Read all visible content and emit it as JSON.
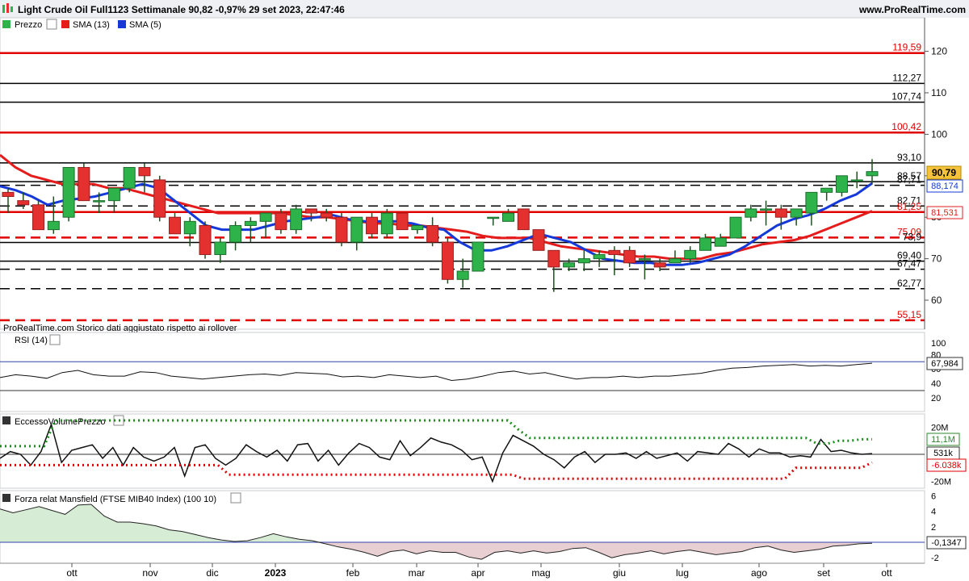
{
  "header": {
    "title": "Light Crude Oil Full1123 Settimanale 90,82 -0,97% 29 set 2023, 22:47:46",
    "site": "www.ProRealTime.com"
  },
  "colors": {
    "up": "#2db34a",
    "down": "#e53030",
    "sma13": "#e51c1c",
    "sma5": "#1538d8",
    "level_red": "#e00000",
    "level_black": "#000000",
    "mansfield_pos_fill": "#d6ecd4",
    "mansfield_neg_fill": "#e8cfd2"
  },
  "price_panel": {
    "legend": [
      {
        "label": "Prezzo",
        "icon": "candle-icon"
      },
      {
        "label": "SMA (13)",
        "icon": "red-square-icon"
      },
      {
        "label": "SMA (5)",
        "icon": "blue-square-icon"
      }
    ],
    "footer_text": "ProRealTime.com  Storico dati aggiustato rispetto ai rollover",
    "current_price_label": "90,79",
    "sma5_label": "88,174",
    "sma13_label": "81,531"
  },
  "rsi_panel": {
    "label": "RSI (14)",
    "value_label": "67,984"
  },
  "volume_panel": {
    "label": "EccessoVolumePrezzo",
    "upper_label": "11,1M",
    "value_label": "531k",
    "lower_label": "-6.038k"
  },
  "mansfield_panel": {
    "label": "Forza relat Mansfield (FTSE MIB40 Index) (100 10)",
    "value_label": "-0,1347"
  },
  "chart_data": [
    {
      "type": "candlestick",
      "title": "Light Crude Oil Full1123 Settimanale",
      "timeframe": "weekly",
      "x_tick_labels": [
        "ott",
        "nov",
        "dic",
        "2023",
        "feb",
        "mar",
        "apr",
        "mag",
        "giu",
        "lug",
        "ago",
        "set",
        "ott"
      ],
      "y_ticks": [
        60,
        70,
        80,
        90,
        100,
        110,
        120
      ],
      "ylim": [
        55,
        125
      ],
      "levels": [
        {
          "value": 119.59,
          "label": "119,59",
          "color": "red",
          "style": "solid"
        },
        {
          "value": 112.27,
          "label": "112,27",
          "color": "black",
          "style": "solid"
        },
        {
          "value": 107.74,
          "label": "107,74",
          "color": "black",
          "style": "solid"
        },
        {
          "value": 100.42,
          "label": "100,42",
          "color": "red",
          "style": "solid"
        },
        {
          "value": 93.1,
          "label": "93,10",
          "color": "black",
          "style": "solid"
        },
        {
          "value": 88.57,
          "label": "88,57",
          "color": "black",
          "style": "solid"
        },
        {
          "value": 87.71,
          "label": "87,71",
          "color": "black",
          "style": "dashed"
        },
        {
          "value": 82.71,
          "label": "82,71",
          "color": "black",
          "style": "dashed"
        },
        {
          "value": 81.25,
          "label": "81,25",
          "color": "red",
          "style": "solid"
        },
        {
          "value": 75.09,
          "label": "75,09",
          "color": "red",
          "style": "dashed"
        },
        {
          "value": 73.9,
          "label": "73,9",
          "color": "black",
          "style": "solid"
        },
        {
          "value": 69.4,
          "label": "69,40",
          "color": "black",
          "style": "solid"
        },
        {
          "value": 67.47,
          "label": "67,47",
          "color": "black",
          "style": "dashed"
        },
        {
          "value": 62.77,
          "label": "62,77",
          "color": "black",
          "style": "dashed"
        },
        {
          "value": 55.15,
          "label": "55,15",
          "color": "red",
          "style": "dashed"
        }
      ],
      "ohlc": [
        [
          86,
          87,
          81,
          85
        ],
        [
          84,
          86,
          82,
          83
        ],
        [
          83,
          84,
          77,
          77
        ],
        [
          77,
          85,
          76,
          79
        ],
        [
          80,
          92,
          79,
          92
        ],
        [
          92,
          93,
          84,
          84
        ],
        [
          84,
          86,
          81,
          84
        ],
        [
          84,
          87,
          81,
          87
        ],
        [
          87,
          92,
          86,
          92
        ],
        [
          92,
          93,
          86,
          90
        ],
        [
          89,
          90,
          79,
          80
        ],
        [
          80,
          81,
          76,
          76
        ],
        [
          76,
          80,
          73,
          79
        ],
        [
          78,
          79,
          70,
          71
        ],
        [
          71,
          75,
          69,
          74
        ],
        [
          74,
          79,
          72,
          78
        ],
        [
          78,
          80,
          74,
          79
        ],
        [
          79,
          81,
          75,
          81
        ],
        [
          81,
          82,
          76,
          77
        ],
        [
          77,
          83,
          76,
          82
        ],
        [
          82,
          82,
          79,
          81
        ],
        [
          81,
          82,
          79,
          80
        ],
        [
          80,
          81,
          73,
          74
        ],
        [
          74,
          80,
          72,
          80
        ],
        [
          80,
          81,
          75,
          76
        ],
        [
          76,
          82,
          75,
          81
        ],
        [
          81,
          81,
          77,
          77
        ],
        [
          77,
          78,
          76,
          78
        ],
        [
          78,
          80,
          73,
          74
        ],
        [
          74,
          75,
          64,
          65
        ],
        [
          65,
          70,
          63,
          67
        ],
        [
          67,
          74,
          67,
          74
        ],
        [
          80,
          80,
          78,
          80
        ],
        [
          79,
          82,
          79,
          81
        ],
        [
          82,
          82,
          77,
          77
        ],
        [
          77,
          77,
          72,
          72
        ],
        [
          72,
          72,
          62,
          68
        ],
        [
          68,
          70,
          67,
          69
        ],
        [
          69,
          72,
          67,
          70
        ],
        [
          70,
          72,
          68,
          71
        ],
        [
          72,
          73,
          66,
          71
        ],
        [
          72,
          73,
          68,
          69
        ],
        [
          70,
          71,
          65,
          70
        ],
        [
          69,
          70,
          67,
          68
        ],
        [
          69,
          72,
          69,
          70
        ],
        [
          70,
          73,
          69,
          72
        ],
        [
          72,
          76,
          72,
          75
        ],
        [
          73,
          76,
          73,
          75
        ],
        [
          75,
          80,
          75,
          80
        ],
        [
          80,
          83,
          79,
          82
        ],
        [
          82,
          84,
          78,
          82
        ],
        [
          82,
          83,
          77,
          80
        ],
        [
          80,
          82,
          78,
          82
        ],
        [
          81,
          86,
          78,
          86
        ],
        [
          86,
          87,
          84,
          87
        ],
        [
          86,
          90,
          85,
          90
        ],
        [
          89,
          91,
          87,
          89
        ],
        [
          90,
          94,
          88,
          91
        ]
      ],
      "series": [
        {
          "name": "SMA (13)",
          "values": [
            95,
            92,
            90,
            89,
            88,
            88,
            88,
            87,
            87,
            86,
            85,
            84,
            83,
            82,
            81,
            81,
            81,
            81,
            81,
            80.5,
            80,
            80,
            79.5,
            79,
            78.5,
            78.5,
            78,
            78,
            77.5,
            77,
            76.5,
            75.5,
            75,
            75,
            75,
            74,
            73,
            72.5,
            72,
            71.5,
            71,
            70.5,
            70.5,
            70,
            70,
            70,
            71,
            71.5,
            72.5,
            73.5,
            74,
            74.5,
            75.5,
            77,
            78.5,
            80,
            81.5
          ]
        },
        {
          "name": "SMA (5)",
          "values": [
            87.5,
            86.5,
            85,
            83,
            84,
            84.5,
            85,
            86,
            87,
            88,
            87,
            84,
            81,
            78,
            77,
            77,
            77,
            78,
            79,
            79.5,
            80,
            80.5,
            79.5,
            79,
            79,
            79,
            78.5,
            77.5,
            77,
            74,
            72,
            72,
            73,
            74.5,
            76,
            75,
            74,
            72,
            70,
            69.5,
            69,
            69,
            68.5,
            68.5,
            69,
            70,
            71,
            73,
            75.5,
            78,
            79.5,
            80.5,
            82,
            84,
            85.5,
            88.2
          ]
        }
      ]
    },
    {
      "type": "line",
      "title": "RSI (14)",
      "y_ticks": [
        20,
        40,
        60,
        80
      ],
      "ylim": [
        0,
        100
      ],
      "series": [
        {
          "name": "RSI (14)",
          "values": [
            48,
            52,
            50,
            47,
            55,
            58,
            52,
            50,
            50,
            56,
            55,
            50,
            48,
            46,
            48,
            50,
            52,
            53,
            51,
            55,
            54,
            53,
            49,
            50,
            48,
            52,
            50,
            48,
            50,
            44,
            46,
            50,
            55,
            57,
            53,
            55,
            50,
            46,
            48,
            48,
            50,
            48,
            50,
            50,
            52,
            54,
            58,
            61,
            62,
            64,
            65,
            66,
            64,
            65,
            64,
            66,
            67.98
          ]
        }
      ]
    },
    {
      "type": "line",
      "title": "EccessoVolumePrezzo",
      "y_ticks": [
        "20M",
        "0",
        "-20M"
      ],
      "series": [
        {
          "name": "EccessoVolumePrezzo",
          "values": [
            -3,
            2,
            0,
            -8,
            2,
            22,
            -6,
            3,
            5,
            7,
            -3,
            5,
            -8,
            5,
            -2,
            -5,
            -2,
            5,
            -16,
            5,
            7,
            -3,
            -8,
            -3,
            7,
            2,
            -2,
            3,
            -5,
            7,
            8,
            -5,
            3,
            -8,
            1,
            8,
            5,
            -2,
            -4,
            10,
            -1,
            5,
            12,
            9,
            7,
            3,
            -4,
            -2,
            -20,
            1,
            14,
            10,
            6,
            0,
            -4,
            -10,
            -2,
            2,
            -6,
            0,
            0,
            1,
            -3,
            2,
            -3,
            -1,
            1,
            -5,
            2,
            1,
            0,
            8,
            4,
            -2,
            4,
            1,
            1,
            -2,
            -1,
            -2,
            11,
            2,
            3,
            1,
            0,
            0.53
          ]
        },
        {
          "name": "upper band",
          "values": [
            6,
            6,
            6,
            6,
            6,
            25,
            25,
            25,
            25,
            25,
            25,
            25,
            25,
            25,
            25,
            25,
            25,
            25,
            25,
            25,
            25,
            25,
            25,
            25,
            25,
            25,
            25,
            25,
            25,
            25,
            25,
            25,
            25,
            25,
            25,
            25,
            25,
            25,
            25,
            25,
            25,
            25,
            25,
            25,
            25,
            25,
            25,
            18,
            12,
            12,
            12,
            12,
            12,
            12,
            12,
            12,
            12,
            12,
            12,
            12,
            12,
            12,
            12,
            12,
            12,
            12,
            12,
            12,
            12,
            12,
            12,
            12,
            12,
            12,
            8,
            8,
            10,
            10,
            11.1,
            11.1
          ]
        },
        {
          "name": "lower band",
          "values": [
            -8,
            -8,
            -8,
            -8,
            -8,
            -8,
            -8,
            -8,
            -8,
            -8,
            -8,
            -8,
            -8,
            -8,
            -8,
            -8,
            -8,
            -8,
            -8,
            -8,
            -8,
            -15,
            -15,
            -15,
            -15,
            -15,
            -15,
            -15,
            -15,
            -15,
            -15,
            -15,
            -15,
            -15,
            -15,
            -15,
            -15,
            -15,
            -15,
            -15,
            -15,
            -15,
            -15,
            -15,
            -15,
            -15,
            -15,
            -15,
            -18,
            -18,
            -18,
            -18,
            -18,
            -18,
            -18,
            -18,
            -18,
            -18,
            -18,
            -18,
            -18,
            -18,
            -18,
            -18,
            -18,
            -18,
            -18,
            -18,
            -18,
            -18,
            -18,
            -18,
            -18,
            -10,
            -10,
            -10,
            -10,
            -10,
            -10,
            -10,
            -6.04
          ]
        }
      ]
    },
    {
      "type": "area",
      "title": "Forza relat Mansfield (FTSE MIB40 Index) (100 10)",
      "y_ticks": [
        -2,
        0,
        2,
        4,
        6
      ],
      "ylim": [
        -3,
        7
      ],
      "series": [
        {
          "name": "Mansfield",
          "values": [
            4.3,
            3.8,
            4.2,
            4.6,
            4.1,
            3.6,
            4.8,
            4.9,
            3.4,
            2.6,
            2.6,
            2.4,
            2.1,
            1.6,
            1.4,
            1.0,
            0.6,
            0.3,
            0.1,
            0.2,
            0.6,
            1.1,
            0.7,
            0.4,
            0.2,
            -0.2,
            -0.6,
            -0.9,
            -1.3,
            -1.8,
            -1.2,
            -1.0,
            -1.5,
            -1.1,
            -1.3,
            -1.3,
            -1.9,
            -2.2,
            -1.3,
            -1.1,
            -1.4,
            -1.1,
            -1.4,
            -1.2,
            -0.8,
            -0.7,
            -1.3,
            -2.0,
            -1.6,
            -1.4,
            -1.1,
            -1.5,
            -1.2,
            -1.0,
            -1.3,
            -1.6,
            -1.4,
            -1.2,
            -0.7,
            -0.5,
            -1.0,
            -1.3,
            -1.1,
            -0.9,
            -0.5,
            -0.4,
            -0.2,
            -0.13
          ]
        }
      ]
    }
  ]
}
